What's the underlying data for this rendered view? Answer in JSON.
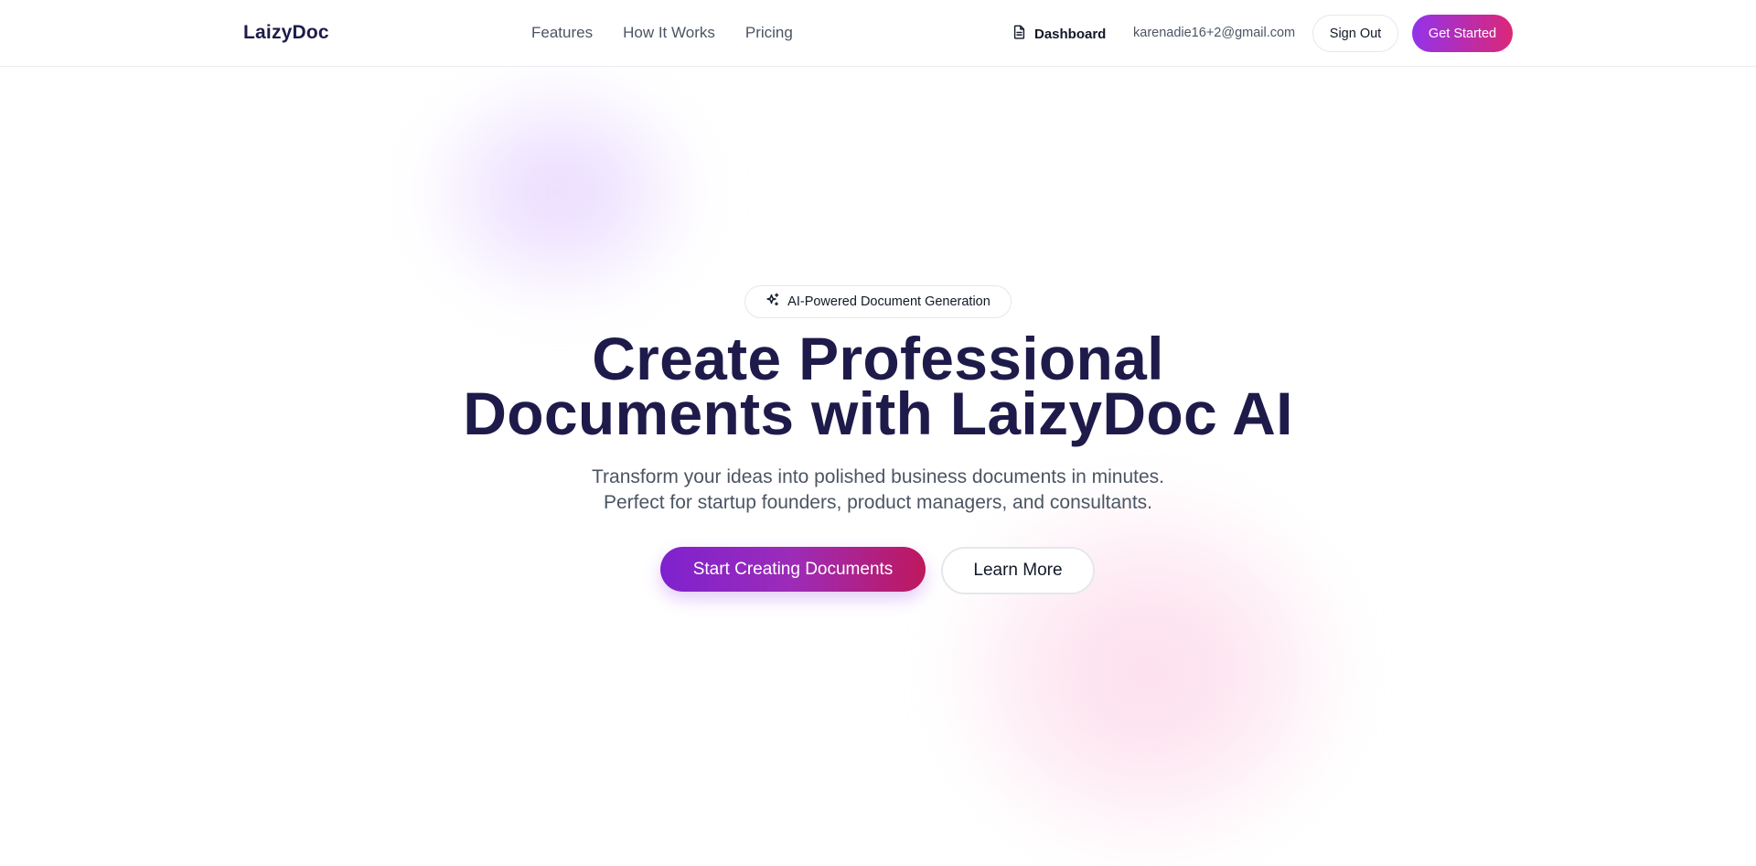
{
  "brand": {
    "name": "LaizyDoc"
  },
  "nav": {
    "items": [
      {
        "label": "Features"
      },
      {
        "label": "How It Works"
      },
      {
        "label": "Pricing"
      }
    ]
  },
  "header": {
    "dashboard_label": "Dashboard",
    "dashboard_icon": "document-icon",
    "user_email": "karenadie16+2@gmail.com",
    "sign_out_label": "Sign Out",
    "get_started_label": "Get Started"
  },
  "hero": {
    "badge_label": "AI-Powered Document Generation",
    "badge_icon": "sparkles-icon",
    "title_line1": "Create Professional",
    "title_line2": "Documents with LaizyDoc AI",
    "subtitle_line1": "Transform your ideas into polished business documents in minutes.",
    "subtitle_line2": "Perfect for startup founders, product managers, and consultants.",
    "primary_cta": "Start Creating Documents",
    "secondary_cta": "Learn More"
  },
  "colors": {
    "brand_dark": "#1e1b4b",
    "gradient_start": "#9333ea",
    "gradient_end": "#db2777",
    "muted_text": "#4b5563"
  }
}
